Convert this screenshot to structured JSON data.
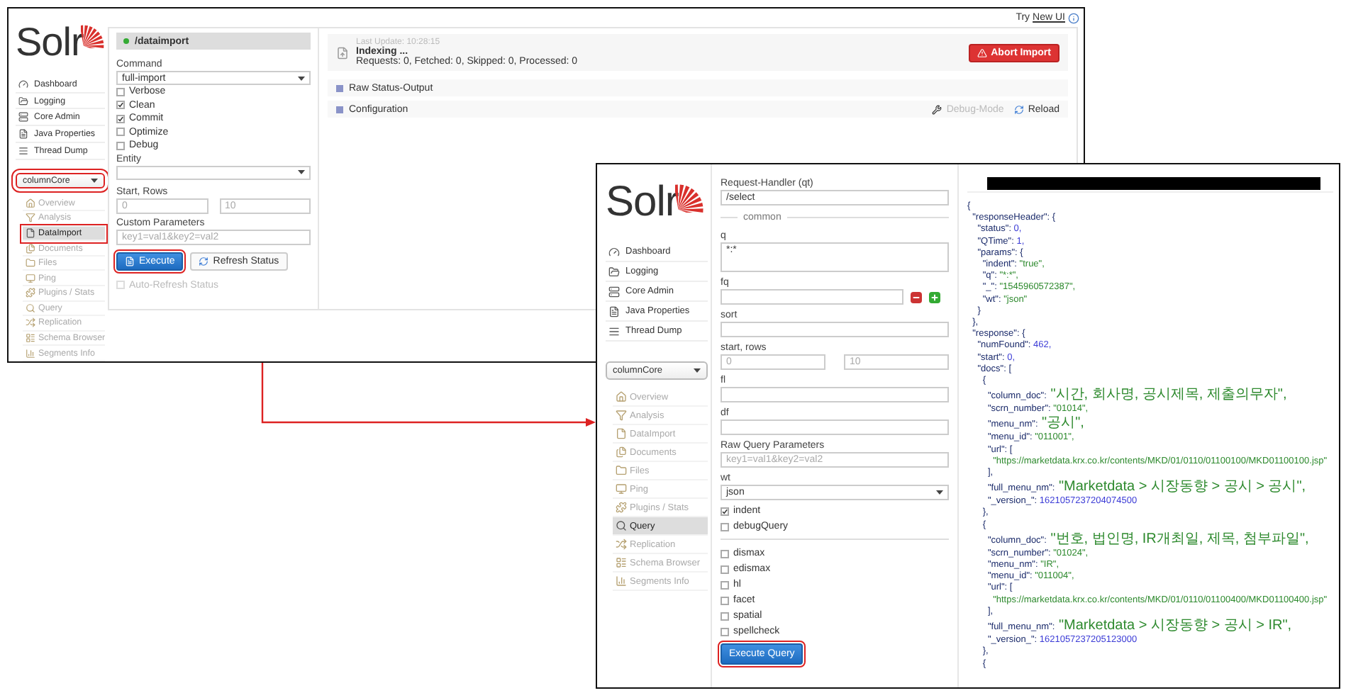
{
  "window_1": {
    "top_bar": {
      "text": "Try",
      "link": "New UI"
    },
    "logo": "Solr",
    "nav": [
      {
        "label": "Dashboard"
      },
      {
        "label": "Logging"
      },
      {
        "label": "Core Admin"
      },
      {
        "label": "Java Properties"
      },
      {
        "label": "Thread Dump"
      }
    ],
    "core_select": {
      "value": "columnCore",
      "highlighted": true
    },
    "core_menu": [
      {
        "label": "Overview",
        "selected": false,
        "highlighted": false
      },
      {
        "label": "Analysis",
        "selected": false,
        "highlighted": false
      },
      {
        "label": "DataImport",
        "selected": true,
        "highlighted": true
      },
      {
        "label": "Documents",
        "selected": false,
        "highlighted": false
      },
      {
        "label": "Files",
        "selected": false,
        "highlighted": false
      },
      {
        "label": "Ping",
        "selected": false,
        "highlighted": false
      },
      {
        "label": "Plugins / Stats",
        "selected": false,
        "highlighted": false
      },
      {
        "label": "Query",
        "selected": false,
        "highlighted": false
      },
      {
        "label": "Replication",
        "selected": false,
        "highlighted": false
      },
      {
        "label": "Schema Browser",
        "selected": false,
        "highlighted": false
      },
      {
        "label": "Segments Info",
        "selected": false,
        "highlighted": false
      }
    ],
    "panel_title": "/dataimport",
    "command": {
      "label": "Command",
      "value": "full-import"
    },
    "options": [
      {
        "label": "Verbose",
        "checked": false
      },
      {
        "label": "Clean",
        "checked": true
      },
      {
        "label": "Commit",
        "checked": true
      },
      {
        "label": "Optimize",
        "checked": false
      },
      {
        "label": "Debug",
        "checked": false
      }
    ],
    "entity": {
      "label": "Entity"
    },
    "start_rows": {
      "label": "Start, Rows",
      "placeholders": [
        "0",
        "10"
      ]
    },
    "custom_parameters": {
      "label": "Custom Parameters",
      "placeholder": "key1=val1&key2=val2"
    },
    "buttons": [
      {
        "label": "Execute",
        "kind": "primary",
        "highlighted": true
      },
      {
        "label": "Refresh Status",
        "kind": "secondary",
        "highlighted": false
      }
    ],
    "auto_refresh": {
      "label": "Auto-Refresh Status",
      "checked": false,
      "disabled": true
    },
    "status": {
      "last_update": "Last Update: 10:28:15",
      "title": "Indexing ...",
      "counts": "Requests: 0, Fetched: 0, Skipped: 0, Processed: 0",
      "abort_button": "Abort Import"
    },
    "sections": [
      {
        "label": "Raw Status-Output"
      },
      {
        "label": "Configuration",
        "debug_mode": "Debug-Mode",
        "reload": "Reload"
      }
    ]
  },
  "window_2": {
    "logo": "Solr",
    "nav": [
      {
        "label": "Dashboard"
      },
      {
        "label": "Logging"
      },
      {
        "label": "Core Admin"
      },
      {
        "label": "Java Properties"
      },
      {
        "label": "Thread Dump"
      }
    ],
    "core_select": {
      "value": "columnCore",
      "highlighted": false
    },
    "core_menu": [
      {
        "label": "Overview",
        "selected": false,
        "highlighted": false
      },
      {
        "label": "Analysis",
        "selected": false,
        "highlighted": false
      },
      {
        "label": "DataImport",
        "selected": false,
        "highlighted": false
      },
      {
        "label": "Documents",
        "selected": false,
        "highlighted": false
      },
      {
        "label": "Files",
        "selected": false,
        "highlighted": false
      },
      {
        "label": "Ping",
        "selected": false,
        "highlighted": false
      },
      {
        "label": "Plugins / Stats",
        "selected": false,
        "highlighted": false
      },
      {
        "label": "Query",
        "selected": true,
        "highlighted": false
      },
      {
        "label": "Replication",
        "selected": false,
        "highlighted": false
      },
      {
        "label": "Schema Browser",
        "selected": false,
        "highlighted": false
      },
      {
        "label": "Segments Info",
        "selected": false,
        "highlighted": false
      }
    ],
    "form": {
      "request_handler": {
        "label": "Request-Handler (qt)",
        "value": "/select"
      },
      "legend": "common",
      "fields": [
        {
          "kind": "textarea",
          "label": "q",
          "value": "*:*"
        },
        {
          "kind": "fq",
          "label": "fq"
        },
        {
          "kind": "input",
          "label": "sort"
        },
        {
          "kind": "pair",
          "label": "start, rows",
          "placeholders": [
            "0",
            "10"
          ]
        },
        {
          "kind": "input",
          "label": "fl"
        },
        {
          "kind": "input",
          "label": "df"
        },
        {
          "kind": "input",
          "label": "Raw Query Parameters",
          "placeholder": "key1=val1&key2=val2"
        },
        {
          "kind": "select",
          "label": "wt",
          "value": "json"
        }
      ],
      "flags": [
        {
          "label": "indent",
          "checked": true
        },
        {
          "label": "debugQuery",
          "checked": false
        }
      ],
      "parsers": [
        {
          "label": "dismax",
          "checked": false
        },
        {
          "label": "edismax",
          "checked": false
        },
        {
          "label": "hl",
          "checked": false
        },
        {
          "label": "facet",
          "checked": false
        },
        {
          "label": "spatial",
          "checked": false
        },
        {
          "label": "spellcheck",
          "checked": false
        }
      ],
      "execute_button": {
        "label": "Execute Query",
        "highlighted": true
      }
    },
    "response": {
      "lines": [
        {
          "text": "{",
          "kind": "plain"
        },
        {
          "text": "  \"responseHeader\": {",
          "kind": "plain"
        },
        {
          "text": "    \"status\": 0,",
          "kind": "number"
        },
        {
          "text": "    \"QTime\": 1,",
          "kind": "number"
        },
        {
          "text": "    \"params\": {",
          "kind": "plain"
        },
        {
          "text": "      \"indent\": \"true\",",
          "kind": "string"
        },
        {
          "text": "      \"q\": \"*:*\",",
          "kind": "string"
        },
        {
          "text": "      \"_\": \"1545960572387\",",
          "kind": "string"
        },
        {
          "text": "      \"wt\": \"json\"",
          "kind": "string"
        },
        {
          "text": "    }",
          "kind": "plain"
        },
        {
          "text": "  },",
          "kind": "plain"
        },
        {
          "text": "  \"response\": {",
          "kind": "plain"
        },
        {
          "text": "    \"numFound\": 462,",
          "kind": "number"
        },
        {
          "text": "    \"start\": 0,",
          "kind": "number"
        },
        {
          "text": "    \"docs\": [",
          "kind": "plain"
        },
        {
          "text": "      {",
          "kind": "plain"
        },
        {
          "text": "        \"column_doc\": \"시간, 회사명, 공시제목, 제출의무자\",",
          "kind": "string"
        },
        {
          "text": "        \"scrn_number\": \"01014\",",
          "kind": "string"
        },
        {
          "text": "        \"menu_nm\": \"공시\",",
          "kind": "string"
        },
        {
          "text": "        \"menu_id\": \"011001\",",
          "kind": "string"
        },
        {
          "text": "        \"url\": [",
          "kind": "plain"
        },
        {
          "text": "          \"https://marketdata.krx.co.kr/contents/MKD/01/0110/01100100/MKD01100100.jsp\"",
          "kind": "string"
        },
        {
          "text": "        ],",
          "kind": "plain"
        },
        {
          "text": "        \"full_menu_nm\": \"Marketdata > 시장동향 > 공시 > 공시\",",
          "kind": "string"
        },
        {
          "text": "        \"_version_\": 1621057237204074500",
          "kind": "number"
        },
        {
          "text": "      },",
          "kind": "plain"
        },
        {
          "text": "      {",
          "kind": "plain"
        },
        {
          "text": "        \"column_doc\": \"번호, 법인명, IR개최일, 제목, 첨부파일\",",
          "kind": "string"
        },
        {
          "text": "        \"scrn_number\": \"01024\",",
          "kind": "string"
        },
        {
          "text": "        \"menu_nm\": \"IR\",",
          "kind": "string"
        },
        {
          "text": "        \"menu_id\": \"011004\",",
          "kind": "string"
        },
        {
          "text": "        \"url\": [",
          "kind": "plain"
        },
        {
          "text": "          \"https://marketdata.krx.co.kr/contents/MKD/01/0110/01100400/MKD01100400.jsp\"",
          "kind": "string"
        },
        {
          "text": "        ],",
          "kind": "plain"
        },
        {
          "text": "        \"full_menu_nm\": \"Marketdata > 시장동향 > 공시 > IR\",",
          "kind": "string"
        },
        {
          "text": "        \"_version_\": 1621057237205123000",
          "kind": "number"
        },
        {
          "text": "      },",
          "kind": "plain"
        },
        {
          "text": "      {",
          "kind": "plain"
        }
      ]
    }
  }
}
